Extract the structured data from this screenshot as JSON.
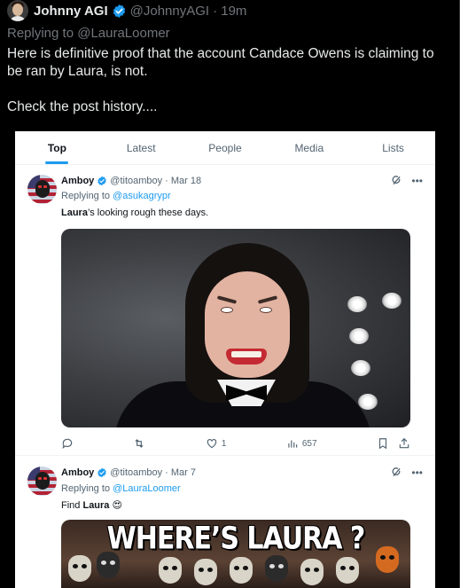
{
  "post": {
    "author_name": "Johnny AGI",
    "author_handle": "@JohnnyAGI",
    "time": "· 19m",
    "replying_prefix": "Replying to ",
    "replying_to": "@LauraLoomer",
    "text_line1": "Here is definitive proof that the account Candace Owens is claiming to be ran by Laura, is not.",
    "text_line2": "Check the post history...."
  },
  "embed": {
    "tabs": [
      "Top",
      "Latest",
      "People",
      "Media",
      "Lists"
    ],
    "active_tab": "Top",
    "tweets": [
      {
        "name": "Amboy",
        "handle": "@titoamboy",
        "date": "· Mar 18",
        "replying_prefix": "Replying to ",
        "replying_to": "@asukagrypr",
        "text_bold": "Laura",
        "text_rest": "’s looking rough these days.",
        "likes": "1",
        "views": "657"
      },
      {
        "name": "Amboy",
        "handle": "@titoamboy",
        "date": "· Mar 7",
        "replying_prefix": "Replying to ",
        "replying_to": "@LauraLoomer",
        "text_prefix": "Find ",
        "text_bold": "Laura",
        "text_emoji": "😍",
        "media_title": "WHERE’S LAURA ?"
      }
    ]
  },
  "icons": {
    "verified": "verified-badge-icon",
    "grok": "grok-icon",
    "more": "more-icon",
    "reply": "reply-icon",
    "retweet": "retweet-icon",
    "like": "like-icon",
    "views": "views-icon",
    "bookmark": "bookmark-icon",
    "share": "share-icon"
  },
  "colors": {
    "accent": "#1d9bf0",
    "background": "#000000",
    "muted": "#71767b"
  }
}
